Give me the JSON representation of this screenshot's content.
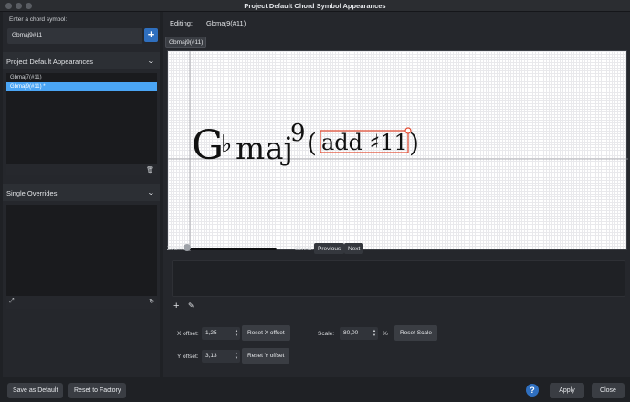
{
  "window": {
    "title": "Project Default Chord Symbol Appearances"
  },
  "left": {
    "chord_prompt": "Enter a chord symbol:",
    "chord_value": "Gbmaj9#11",
    "add_icon": "plus-icon",
    "defaults_section": {
      "title": "Project Default Appearances",
      "items": [
        {
          "label": "Gbmaj7(#11)",
          "selected": false
        },
        {
          "label": "Gbmaj9(#11) *",
          "selected": true
        }
      ]
    },
    "overrides_section": {
      "title": "Single Overrides"
    }
  },
  "editor": {
    "editing_label": "Editing:",
    "editing_value": "Gbmaj9(#11)",
    "tab_label": "Gbmaj9(#11)",
    "chord": {
      "root": "G",
      "accidental": "♭",
      "quality": "maj",
      "extension": "9",
      "open_paren": "(",
      "alteration": "add ♯11",
      "close_paren": ")"
    },
    "zoom_label": "Zoom:",
    "zoom_level": 0,
    "select_label": "Select:",
    "previous_label": "Previous",
    "next_label": "Next",
    "x_offset_label": "X offset:",
    "x_offset_value": "1,25",
    "reset_x_label": "Reset X offset",
    "y_offset_label": "Y offset:",
    "y_offset_value": "3,13",
    "reset_y_label": "Reset Y offset",
    "scale_label": "Scale:",
    "scale_value": "80,00",
    "scale_unit": "%",
    "reset_scale_label": "Reset Scale"
  },
  "footer": {
    "save_default_label": "Save as Default",
    "reset_factory_label": "Reset to Factory",
    "help_label": "?",
    "apply_label": "Apply",
    "close_label": "Close"
  },
  "colors": {
    "accent": "#2f6fbf",
    "selection": "#4aa5f5",
    "handle": "#e0452b"
  }
}
